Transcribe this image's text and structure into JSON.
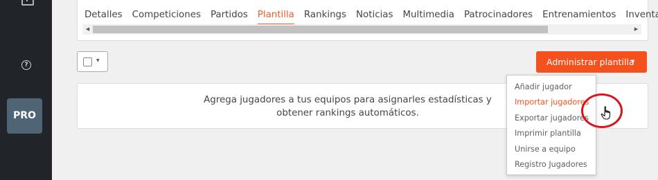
{
  "sidebar": {
    "top_icon": "dashboard-icon",
    "help_icon": "help-circle-icon",
    "help_glyph": "?",
    "pro_label": "PRO"
  },
  "tabs": [
    {
      "label": "Detalles",
      "active": false
    },
    {
      "label": "Competiciones",
      "active": false
    },
    {
      "label": "Partidos",
      "active": false
    },
    {
      "label": "Plantilla",
      "active": true
    },
    {
      "label": "Rankings",
      "active": false
    },
    {
      "label": "Noticias",
      "active": false
    },
    {
      "label": "Multimedia",
      "active": false
    },
    {
      "label": "Patrocinadores",
      "active": false
    },
    {
      "label": "Entrenamientos",
      "active": false
    },
    {
      "label": "Inventario",
      "active": false
    }
  ],
  "scrollbar": {
    "left_arrow": "◀",
    "right_arrow": "▶"
  },
  "select_control": {
    "caret": "▼"
  },
  "admin_button": {
    "label": "Administrar plantilla",
    "caret": "▼",
    "color": "#f4511e"
  },
  "empty_state": {
    "line1": "Agrega jugadores a tus equipos para asignarles estadísticas y",
    "line2": "obtener rankings automáticos.",
    "badge": "?"
  },
  "dropdown_menu": [
    {
      "label": "Añadir jugador",
      "highlighted": false
    },
    {
      "label": "Importar jugadores",
      "highlighted": true
    },
    {
      "label": "Exportar jugadores",
      "highlighted": false
    },
    {
      "label": "Imprimir plantilla",
      "highlighted": false
    },
    {
      "label": "Unirse a equipo",
      "highlighted": false
    },
    {
      "label": "Registro Jugadores",
      "highlighted": false
    }
  ],
  "accent_color": "#f15a29"
}
